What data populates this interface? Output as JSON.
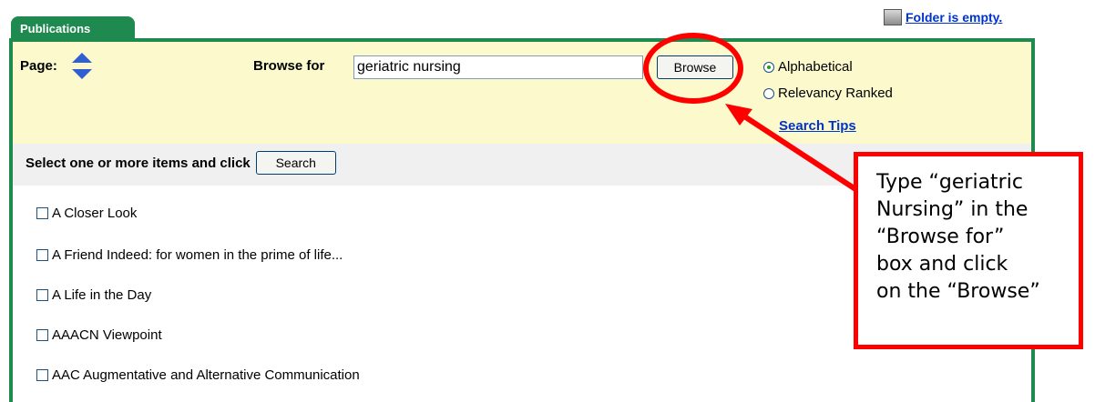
{
  "tab": {
    "label": "Publications"
  },
  "folder": {
    "icon": "folder-icon",
    "link_text": "Folder is empty."
  },
  "header": {
    "page_label": "Page:",
    "browse_label": "Browse for",
    "browse_value": "geriatric nursing",
    "browse_button": "Browse",
    "radio_alphabetical": "Alphabetical",
    "radio_relevancy": "Relevancy Ranked",
    "search_tips": "Search Tips"
  },
  "select_bar": {
    "label": "Select one or more items and click",
    "search_button": "Search"
  },
  "items": [
    {
      "label": "A Closer Look"
    },
    {
      "label": "A Friend Indeed: for women in the prime of life..."
    },
    {
      "label": "A Life in the Day"
    },
    {
      "label": "AAACN Viewpoint"
    },
    {
      "label": "AAC Augmentative and Alternative Communication"
    }
  ],
  "callout": {
    "lines": [
      "Type “geriatric",
      "Nursing” in the",
      "“Browse for”",
      "box and click",
      "on the “Browse”"
    ]
  },
  "colors": {
    "frame": "#1e8a4f",
    "highlight": "#ff0000",
    "link": "#0033cc",
    "panel": "#fcf9cd"
  }
}
